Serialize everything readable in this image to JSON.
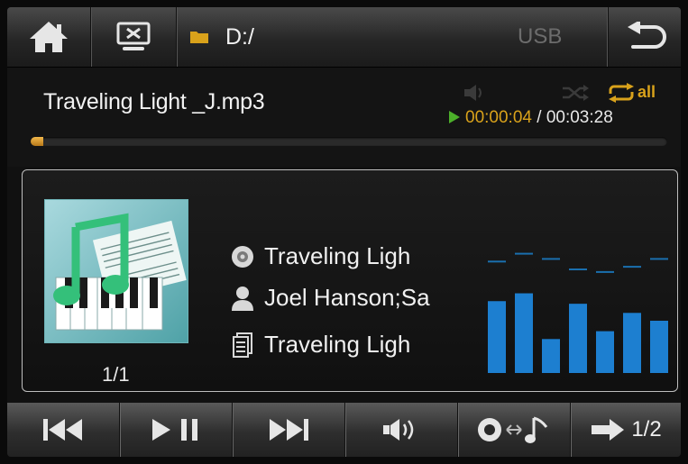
{
  "topbar": {
    "path": "D:/",
    "source": "USB"
  },
  "now_playing": {
    "filename": "Traveling Light _J.mp3",
    "repeat_label": "all",
    "elapsed": "00:00:04",
    "separator": "/",
    "total": "00:03:28",
    "progress_fraction": 0.02
  },
  "panel": {
    "track_counter": "1/1",
    "title": "Traveling Ligh",
    "artist": "Joel Hanson;Sa",
    "album": "Traveling Ligh",
    "equalizer_levels": [
      0.55,
      0.61,
      0.26,
      0.53,
      0.32,
      0.46,
      0.4
    ],
    "equalizer_peaks": [
      0.86,
      0.92,
      0.88,
      0.8,
      0.78,
      0.82,
      0.88
    ]
  },
  "bottombar": {
    "page": "1/2"
  },
  "colors": {
    "accent": "#d9a21b",
    "play_green": "#4caf2a",
    "eq_blue": "#1d7fd0",
    "eq_peak": "#1a6fae"
  }
}
